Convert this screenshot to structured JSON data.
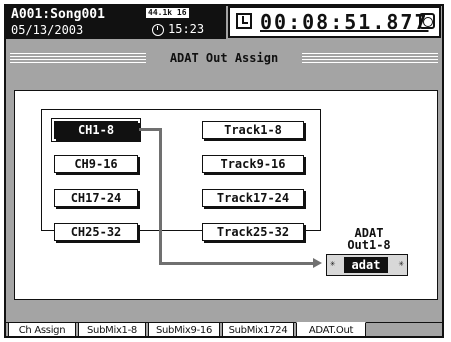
{
  "header": {
    "song_name": "A001:Song001",
    "date": "05/13/2003",
    "rate_badge": "44.1k 16",
    "clock_time": "15:23",
    "counter": "00:08:51.877"
  },
  "title": "ADAT Out Assign",
  "channels": [
    "CH1-8",
    "CH9-16",
    "CH17-24",
    "CH25-32"
  ],
  "tracks": [
    "Track1-8",
    "Track9-16",
    "Track17-24",
    "Track25-32"
  ],
  "selected_source": "CH1-8",
  "adat": {
    "label_line1": "ADAT",
    "label_line2": "Out1-8",
    "value": "adat"
  },
  "tabs": [
    "Ch Assign",
    "SubMix1-8",
    "SubMix9-16",
    "SubMix1724",
    "ADAT.Out"
  ],
  "active_tab": "ADAT.Out",
  "colors": {
    "screen_bg": "#a4a4a4",
    "panel_bg": "#ffffff",
    "ink": "#111111",
    "wire": "#707070"
  },
  "icons": {
    "clock": "clock-icon",
    "timer": "timer-icon",
    "alarm": "alarm-clock-icon"
  }
}
